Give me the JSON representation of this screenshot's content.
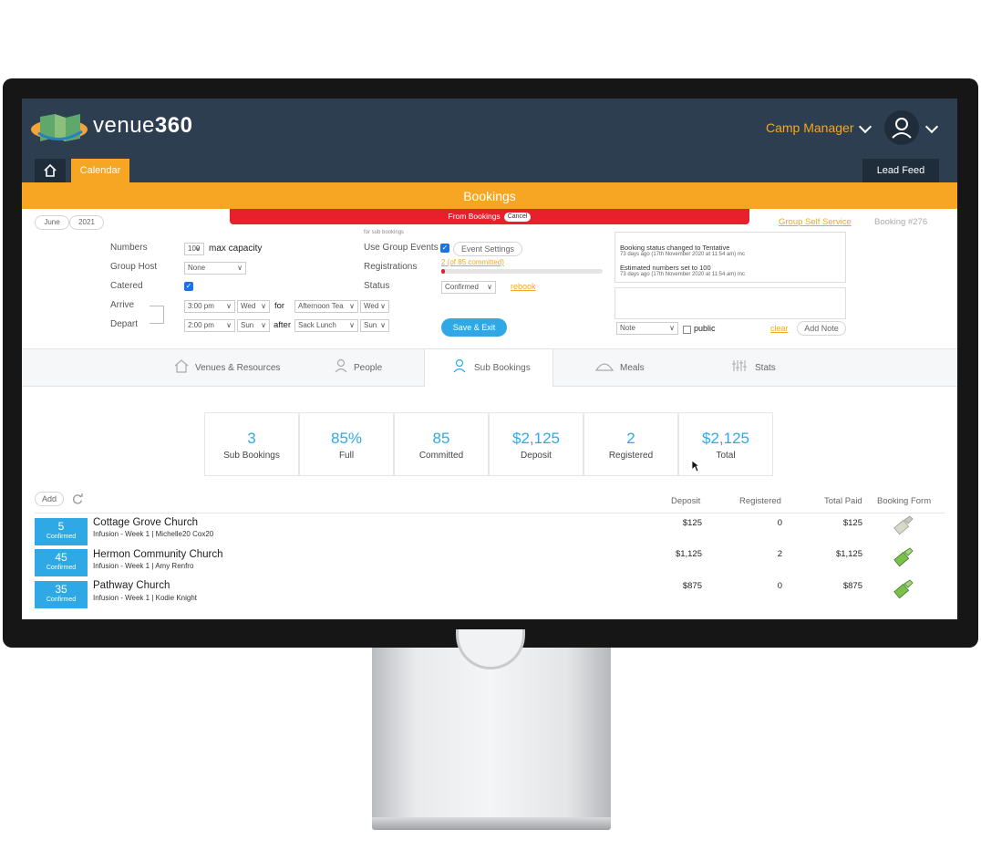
{
  "header": {
    "logo_text_light": "venue",
    "logo_text_bold": "360",
    "role": "Camp Manager",
    "tabs": {
      "calendar": "Calendar",
      "lead_feed": "Lead Feed"
    }
  },
  "page": {
    "title": "Bookings",
    "red_bar_text": "From Bookings",
    "cancel_label": "Cancel",
    "month": "June",
    "year": "2021",
    "group_self_service": "Group Self Service",
    "booking_id": "Booking #276"
  },
  "form": {
    "numbers_label": "Numbers",
    "numbers_value": "100",
    "max_capacity": "max capacity",
    "group_host_label": "Group Host",
    "group_host_value": "None",
    "catered_label": "Catered",
    "arrive_label": "Arrive",
    "arrive_time": "3:00 pm",
    "arrive_day": "Wed",
    "for_label": "for",
    "arrive_meal": "Afternoon Tea",
    "arrive_meal_day": "Wed",
    "depart_label": "Depart",
    "depart_time": "2:00 pm",
    "depart_day": "Sun",
    "after_label": "after",
    "depart_meal": "Sack Lunch",
    "depart_meal_day": "Sun",
    "sub_bookings_note": "for sub bookings",
    "use_group_events_label": "Use Group Events",
    "event_settings": "Event Settings",
    "registrations_label": "Registrations",
    "registrations_value": "2 (of 85 committed)",
    "registrations_progress": 0.02,
    "status_label": "Status",
    "status_value": "Confirmed",
    "rebook": "rebook",
    "save_exit": "Save & Exit"
  },
  "log": {
    "entries": [
      {
        "text": "Booking status changed to Tentative",
        "meta": "73 days ago (17th November 2020 at 11:54 am) mc"
      },
      {
        "text": "Estimated numbers set to 100",
        "meta": "73 days ago (17th November 2020 at 11:54 am) mc"
      }
    ],
    "note_select": "Note",
    "public_label": "public",
    "clear": "clear",
    "add_note": "Add Note"
  },
  "tabs": [
    {
      "label": "Venues & Resources",
      "icon": "house-icon"
    },
    {
      "label": "People",
      "icon": "person-icon"
    },
    {
      "label": "Sub Bookings",
      "icon": "person-icon"
    },
    {
      "label": "Meals",
      "icon": "cloche-icon"
    },
    {
      "label": "Stats",
      "icon": "sliders-icon"
    }
  ],
  "stats": [
    {
      "value": "3",
      "caption": "Sub Bookings"
    },
    {
      "value": "85%",
      "caption": "Full"
    },
    {
      "value": "85",
      "caption": "Committed"
    },
    {
      "value": "$2,125",
      "caption": "Deposit"
    },
    {
      "value": "2",
      "caption": "Registered"
    },
    {
      "value": "$2,125",
      "caption": "Total"
    }
  ],
  "table": {
    "add": "Add",
    "columns": [
      "Deposit",
      "Registered",
      "Total Paid",
      "Booking Form"
    ],
    "rows": [
      {
        "count": "5",
        "status": "Confirmed",
        "name": "Cottage Grove Church",
        "sub": "Infusion - Week 1 | Michelle20 Cox20",
        "deposit": "$125",
        "registered": "0",
        "total_paid": "$125",
        "form_state": "pending"
      },
      {
        "count": "45",
        "status": "Confirmed",
        "name": "Hermon Community Church",
        "sub": "Infusion - Week 1 | Amy Renfro",
        "deposit": "$1,125",
        "registered": "2",
        "total_paid": "$1,125",
        "form_state": "done"
      },
      {
        "count": "35",
        "status": "Confirmed",
        "name": "Pathway Church",
        "sub": "Infusion - Week 1 | Kodie Knight",
        "deposit": "$875",
        "registered": "0",
        "total_paid": "$875",
        "form_state": "done"
      }
    ]
  },
  "colors": {
    "accent": "#f6a623",
    "header": "#2d3e50",
    "blue": "#2fa9e6",
    "red": "#e6212b"
  }
}
